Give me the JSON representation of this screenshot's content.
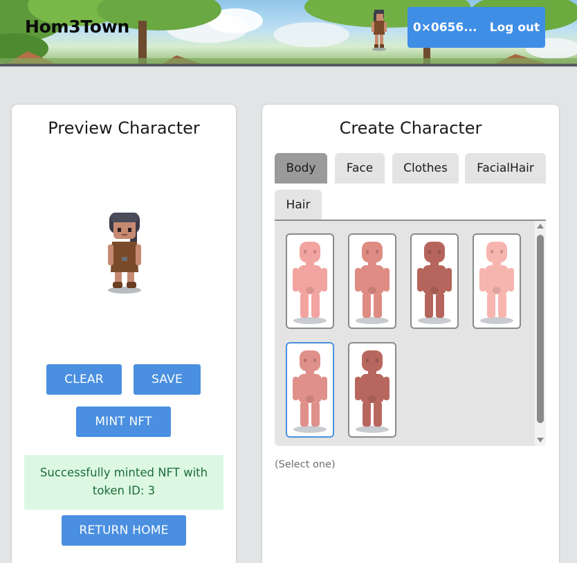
{
  "header": {
    "brand": "Hom3Town",
    "account_address": "0×0656...",
    "logout_label": "Log out"
  },
  "preview": {
    "title": "Preview Character",
    "clear_label": "CLEAR",
    "save_label": "SAVE",
    "mint_label": "MINT NFT",
    "success_line1": "Successfully minted NFT with",
    "success_line2": "token ID: 3",
    "return_label": "RETURN HOME"
  },
  "create": {
    "title": "Create Character",
    "tabs": [
      {
        "label": "Body",
        "active": true
      },
      {
        "label": "Face",
        "active": false
      },
      {
        "label": "Clothes",
        "active": false
      },
      {
        "label": "FacialHair",
        "active": false
      },
      {
        "label": "Hair",
        "active": false
      }
    ],
    "body_options": [
      {
        "skin": "#f2a4a0",
        "selected": false
      },
      {
        "skin": "#de8b83",
        "selected": false
      },
      {
        "skin": "#b5655b",
        "selected": false
      },
      {
        "skin": "#f7b5b0",
        "selected": false
      },
      {
        "skin": "#e0908a",
        "selected": true
      },
      {
        "skin": "#b8675f",
        "selected": false
      }
    ],
    "hint": "(Select one)"
  },
  "colors": {
    "accent": "#4a8fe0",
    "success_bg": "#dcf8e3",
    "success_text": "#1c6b37",
    "tab_active": "#9a9a9a",
    "tab_inactive": "#e4e4e4"
  }
}
